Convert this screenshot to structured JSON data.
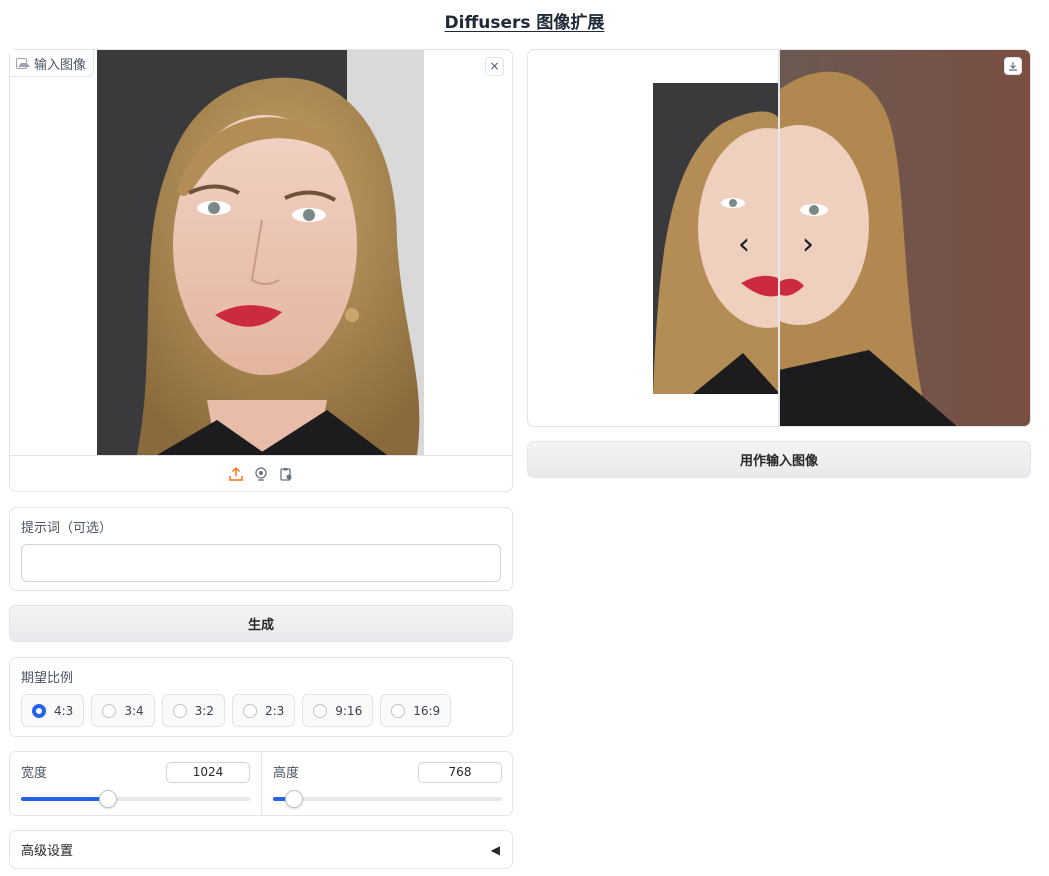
{
  "app": {
    "title": "Diffusers 图像扩展"
  },
  "input_image": {
    "label": "输入图像",
    "close": "×",
    "toolbar_icons": [
      "upload-icon",
      "webcam-icon",
      "clipboard-icon"
    ]
  },
  "output_image": {
    "left_arrow": "‹",
    "right_arrow": "›",
    "download_icon": "download-icon"
  },
  "use_as_input_button": {
    "label": "用作输入图像"
  },
  "prompt": {
    "label": "提示词（可选）",
    "value": "",
    "placeholder": ""
  },
  "generate_button": {
    "label": "生成"
  },
  "ratio": {
    "label": "期望比例",
    "options": [
      "4:3",
      "3:4",
      "3:2",
      "2:3",
      "9:16",
      "16:9"
    ],
    "selected": "4:3"
  },
  "width": {
    "label": "宽度",
    "value": "1024",
    "slider_fraction": 0.38
  },
  "height": {
    "label": "高度",
    "value": "768",
    "slider_fraction": 0.09
  },
  "advanced": {
    "label": "高级设置",
    "toggle": "◀"
  },
  "colors": {
    "accent": "#2563eb",
    "upload_icon": "#f97316",
    "lip": "#cc2a3e"
  }
}
